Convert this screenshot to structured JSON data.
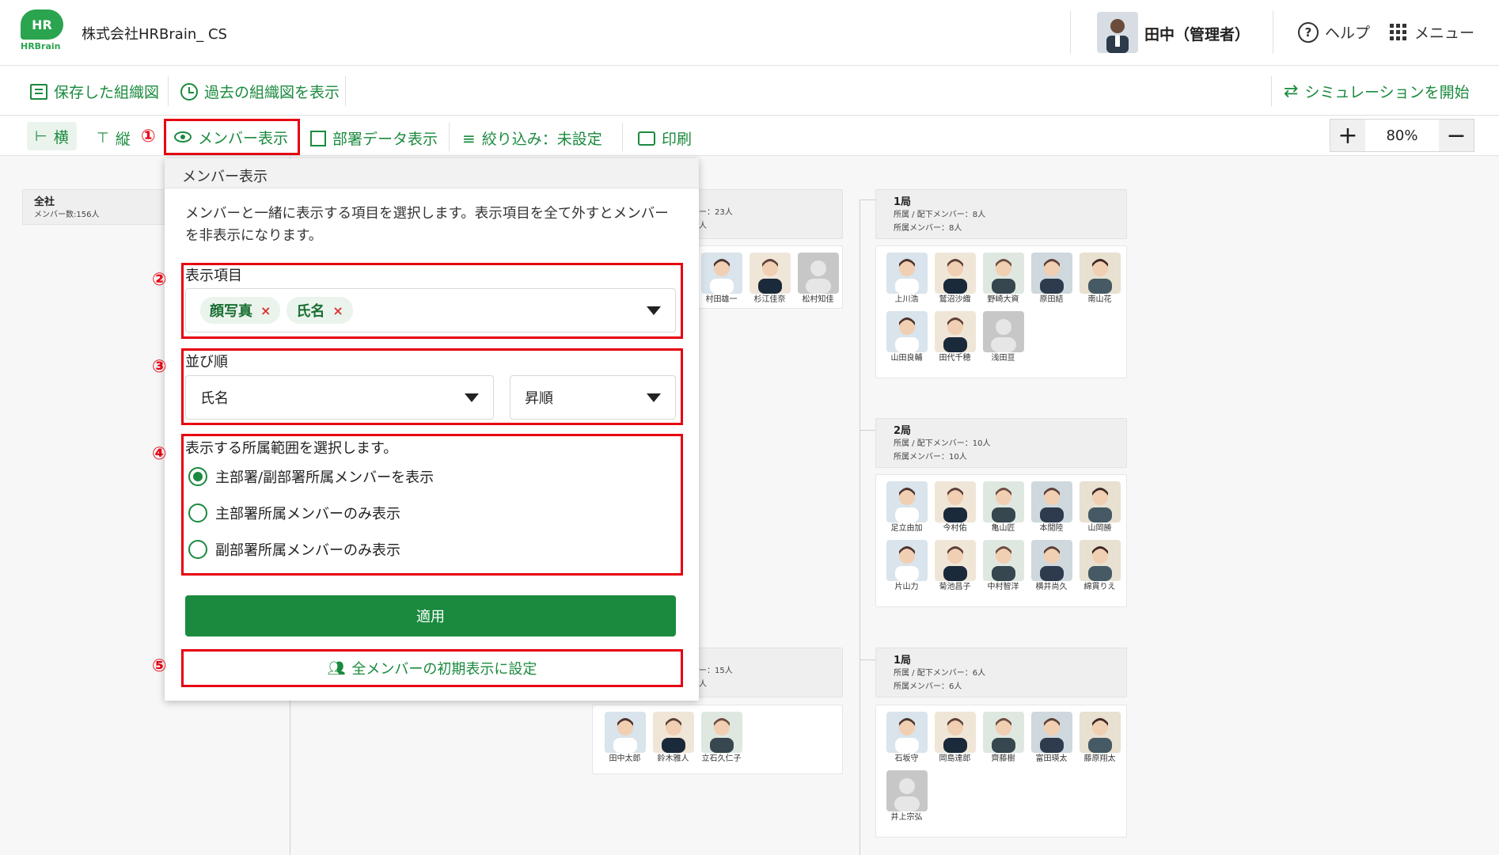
{
  "header": {
    "logo_top": "HR",
    "logo_bottom": "HRBrain",
    "company": "株式会社HRBrain_ CS",
    "user": "田中（管理者）",
    "help": "ヘルプ",
    "menu": "メニュー"
  },
  "toolbar1": {
    "saved": "保存した組織図",
    "past": "過去の組織図を表示",
    "simulate": "シミュレーションを開始"
  },
  "toolbar2": {
    "horizontal": "横",
    "vertical": "縦",
    "member_display": "メンバー表示",
    "dept_data": "部署データ表示",
    "filter": "絞り込み：未設定",
    "print": "印刷",
    "zoom": "80%"
  },
  "annotations": {
    "n1": "①",
    "n2": "②",
    "n3": "③",
    "n4": "④",
    "n5": "⑤"
  },
  "panel": {
    "title": "メンバー表示",
    "desc": "メンバーと一緒に表示する項目を選択します。表示項目を全て外すとメンバーを非表示になります。",
    "items_label": "表示項目",
    "chips": [
      "顔写真",
      "氏名"
    ],
    "sort_label": "並び順",
    "sort_key": "氏名",
    "sort_order": "昇順",
    "scope_label": "表示する所属範囲を選択します。",
    "scope_options": [
      "主部署/副部署所属メンバーを表示",
      "主部署所属メンバーのみ表示",
      "副部署所属メンバーのみ表示"
    ],
    "scope_selected": 0,
    "apply": "適用",
    "set_default": "全メンバーの初期表示に設定"
  },
  "org": {
    "root": {
      "title": "全社",
      "sub": "メンバー数:156人"
    },
    "mid_top": {
      "sub1": "ー：23人",
      "sub2": "人",
      "members": [
        "村田雄一",
        "杉江佳奈",
        "松村知佳"
      ]
    },
    "mid_bottom": {
      "sub1": "ー：15人",
      "sub2": "人",
      "members": [
        "田中太郎",
        "鈴木雅人",
        "立石久仁子"
      ]
    },
    "d1": {
      "title": "1局",
      "sub1": "所属 / 配下メンバー：8人",
      "sub2": "所属メンバー：8人",
      "members": [
        "上川浩",
        "鷲沼沙織",
        "野崎大資",
        "原田結",
        "南山花",
        "山田良輔",
        "田代千穂",
        "浅田亘"
      ]
    },
    "d2": {
      "title": "2局",
      "sub1": "所属 / 配下メンバー：10人",
      "sub2": "所属メンバー：10人",
      "members": [
        "足立由加",
        "今村佑",
        "亀山匠",
        "本間陸",
        "山岡勝",
        "片山力",
        "菊池昌子",
        "中村智洋",
        "横井尚久",
        "綿貫りえ"
      ]
    },
    "d3": {
      "title": "1局",
      "sub1": "所属 / 配下メンバー：6人",
      "sub2": "所属メンバー：6人",
      "members": [
        "石坂守",
        "岡島達郎",
        "齊藤樹",
        "富田瑛太",
        "藤原翔太",
        "井上宗弘"
      ]
    }
  },
  "colors": {
    "brand": "#1a8a3e",
    "annotation": "#e60012"
  }
}
